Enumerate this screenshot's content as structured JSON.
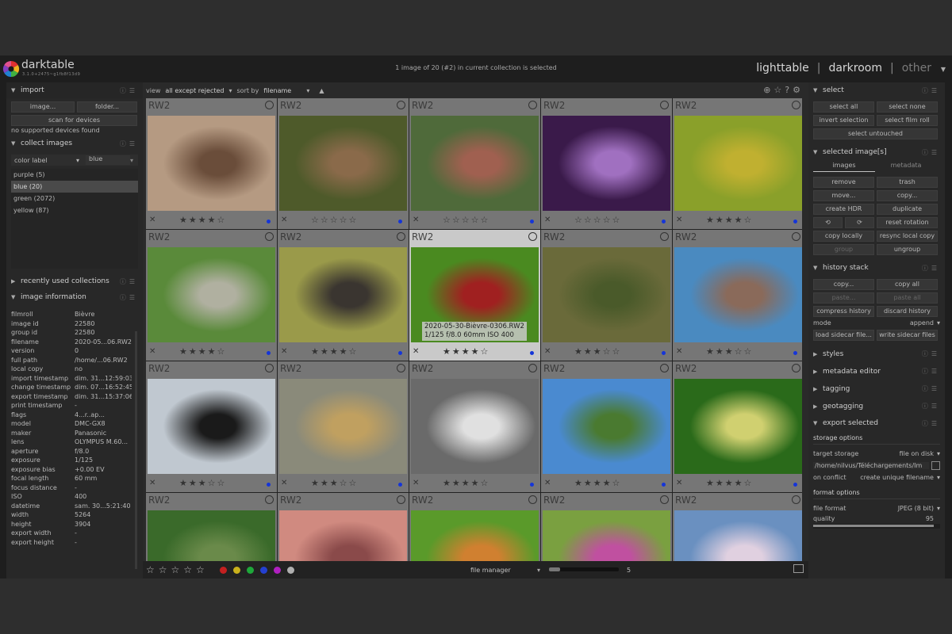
{
  "header": {
    "app_name": "darktable",
    "version": "3.1.0+2475~g1fb8f13d9",
    "status": "1 image of 20 (#2) in current collection is selected",
    "views": [
      "lighttable",
      "darkroom",
      "other"
    ],
    "separator": "|"
  },
  "left": {
    "import": {
      "title": "import",
      "image_btn": "image...",
      "folder_btn": "folder...",
      "scan_btn": "scan for devices",
      "no_devices": "no supported devices found"
    },
    "collect": {
      "title": "collect images",
      "property": "color label",
      "value": "blue",
      "items": [
        "purple (5)",
        "blue (20)",
        "green (2072)",
        "yellow (87)"
      ],
      "selected_index": 1
    },
    "recent": {
      "title": "recently used collections"
    },
    "info": {
      "title": "image information",
      "rows": [
        [
          "filmroll",
          "Bièvre"
        ],
        [
          "image id",
          "22580"
        ],
        [
          "group id",
          "22580"
        ],
        [
          "filename",
          "2020-05...06.RW2"
        ],
        [
          "version",
          "0"
        ],
        [
          "full path",
          "/home/...06.RW2"
        ],
        [
          "local copy",
          "no"
        ],
        [
          "import timestamp",
          "dim. 31...12:59:03"
        ],
        [
          "change timestamp",
          "dim. 07...16:52:45"
        ],
        [
          "export timestamp",
          "dim. 31...15:37:06"
        ],
        [
          "print timestamp",
          "-"
        ],
        [
          "flags",
          "4...r..ap..."
        ],
        [
          "model",
          "DMC-GX8"
        ],
        [
          "maker",
          "Panasonic"
        ],
        [
          "lens",
          "OLYMPUS M.60..."
        ],
        [
          "aperture",
          "f/8.0"
        ],
        [
          "exposure",
          "1/125"
        ],
        [
          "exposure bias",
          "+0.00 EV"
        ],
        [
          "focal length",
          "60 mm"
        ],
        [
          "focus distance",
          "-"
        ],
        [
          "ISO",
          "400"
        ],
        [
          "datetime",
          "sam. 30...5:21:40"
        ],
        [
          "width",
          "5264"
        ],
        [
          "height",
          "3904"
        ],
        [
          "export width",
          "-"
        ],
        [
          "export height",
          "-"
        ]
      ]
    }
  },
  "toolbar": {
    "view_label": "view",
    "view_value": "all except rejected",
    "sort_label": "sort by",
    "sort_value": "filename"
  },
  "grid": {
    "format_label": "RW2",
    "reject_glyph": "✕",
    "hover_info_line1": "2020-05-30-Bièvre-0306.RW2",
    "hover_info_line2": "1/125 f/8.0 60mm ISO 400",
    "cells": [
      {
        "stars": 4,
        "bg": "#b59a82",
        "fg": "#6a4d3a"
      },
      {
        "stars": 0,
        "bg": "#4e5a2a",
        "fg": "#8a6a4a"
      },
      {
        "stars": 0,
        "bg": "#4f6a3a",
        "fg": "#a06050"
      },
      {
        "stars": 0,
        "bg": "#3a1a4a",
        "fg": "#a070c0"
      },
      {
        "stars": 4,
        "bg": "#8aa02a",
        "fg": "#c0b030"
      },
      {
        "stars": 4,
        "bg": "#5a8a3a",
        "fg": "#b0b0a0"
      },
      {
        "stars": 4,
        "bg": "#9a9a4a",
        "fg": "#3a3530"
      },
      {
        "stars": 4,
        "bg": "#4a8a20",
        "fg": "#a02020",
        "hover": true
      },
      {
        "stars": 3,
        "bg": "#6a6a3a",
        "fg": "#4a5a2a"
      },
      {
        "stars": 3,
        "bg": "#4a8ac0",
        "fg": "#8a6a5a"
      },
      {
        "stars": 3,
        "bg": "#c0c8d0",
        "fg": "#1a1a1a"
      },
      {
        "stars": 3,
        "bg": "#8a8a7a",
        "fg": "#c0a060"
      },
      {
        "stars": 4,
        "bg": "#6a6a6a",
        "fg": "#e0e0e0"
      },
      {
        "stars": 4,
        "bg": "#4a8ad0",
        "fg": "#4a7a30"
      },
      {
        "stars": 4,
        "bg": "#2a6a1a",
        "fg": "#d0d070"
      },
      {
        "stars": 0,
        "bg": "#3a6a2a",
        "fg": "#6a8a4a"
      },
      {
        "stars": 0,
        "bg": "#d08a80",
        "fg": "#8a4a4a"
      },
      {
        "stars": 0,
        "bg": "#5a9a2a",
        "fg": "#d08030"
      },
      {
        "stars": 0,
        "bg": "#7aa040",
        "fg": "#c050a0"
      },
      {
        "stars": 0,
        "bg": "#6a90c0",
        "fg": "#e0d0e0"
      }
    ]
  },
  "bottombar": {
    "layout": "file manager",
    "zoom": "5",
    "color_labels": [
      "#c42020",
      "#c9b11c",
      "#1ea83a",
      "#2440d0",
      "#b020c0",
      "#b0b0b0"
    ]
  },
  "right": {
    "select": {
      "title": "select",
      "buttons": [
        "select all",
        "select none",
        "invert selection",
        "select film roll",
        "select untouched"
      ]
    },
    "selected": {
      "title": "selected image[s]",
      "tab_images": "images",
      "tab_metadata": "metadata",
      "buttons": [
        "remove",
        "trash",
        "move...",
        "copy...",
        "create HDR",
        "duplicate",
        "⟲",
        "⟳",
        "reset rotation",
        "copy locally",
        "resync local copy",
        "group",
        "ungroup"
      ]
    },
    "history": {
      "title": "history stack",
      "buttons": [
        "copy...",
        "copy all",
        "paste...",
        "paste all",
        "compress history",
        "discard history"
      ],
      "mode_label": "mode",
      "mode_value": "append",
      "load_btn": "load sidecar file...",
      "write_btn": "write sidecar files"
    },
    "collapsed": [
      "styles",
      "metadata editor",
      "tagging",
      "geotagging"
    ],
    "export": {
      "title": "export selected",
      "storage_title": "storage options",
      "target_label": "target storage",
      "target_value": "file on disk",
      "path": "/home/nilvus/Téléchargements/Im",
      "conflict_label": "on conflict",
      "conflict_value": "create unique filename",
      "format_title": "format options",
      "format_label": "file format",
      "format_value": "JPEG (8 bit)",
      "quality_label": "quality",
      "quality_value": "95",
      "quality_fraction": 0.95
    }
  }
}
